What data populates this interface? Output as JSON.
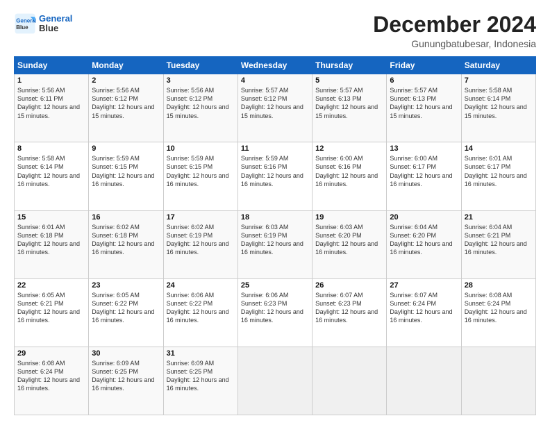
{
  "logo": {
    "line1": "General",
    "line2": "Blue"
  },
  "header": {
    "month": "December 2024",
    "location": "Gunungbatubesar, Indonesia"
  },
  "weekdays": [
    "Sunday",
    "Monday",
    "Tuesday",
    "Wednesday",
    "Thursday",
    "Friday",
    "Saturday"
  ],
  "weeks": [
    [
      {
        "day": "1",
        "sunrise": "5:56 AM",
        "sunset": "6:11 PM",
        "daylight": "12 hours and 15 minutes."
      },
      {
        "day": "2",
        "sunrise": "5:56 AM",
        "sunset": "6:12 PM",
        "daylight": "12 hours and 15 minutes."
      },
      {
        "day": "3",
        "sunrise": "5:56 AM",
        "sunset": "6:12 PM",
        "daylight": "12 hours and 15 minutes."
      },
      {
        "day": "4",
        "sunrise": "5:57 AM",
        "sunset": "6:12 PM",
        "daylight": "12 hours and 15 minutes."
      },
      {
        "day": "5",
        "sunrise": "5:57 AM",
        "sunset": "6:13 PM",
        "daylight": "12 hours and 15 minutes."
      },
      {
        "day": "6",
        "sunrise": "5:57 AM",
        "sunset": "6:13 PM",
        "daylight": "12 hours and 15 minutes."
      },
      {
        "day": "7",
        "sunrise": "5:58 AM",
        "sunset": "6:14 PM",
        "daylight": "12 hours and 15 minutes."
      }
    ],
    [
      {
        "day": "8",
        "sunrise": "5:58 AM",
        "sunset": "6:14 PM",
        "daylight": "12 hours and 16 minutes."
      },
      {
        "day": "9",
        "sunrise": "5:59 AM",
        "sunset": "6:15 PM",
        "daylight": "12 hours and 16 minutes."
      },
      {
        "day": "10",
        "sunrise": "5:59 AM",
        "sunset": "6:15 PM",
        "daylight": "12 hours and 16 minutes."
      },
      {
        "day": "11",
        "sunrise": "5:59 AM",
        "sunset": "6:16 PM",
        "daylight": "12 hours and 16 minutes."
      },
      {
        "day": "12",
        "sunrise": "6:00 AM",
        "sunset": "6:16 PM",
        "daylight": "12 hours and 16 minutes."
      },
      {
        "day": "13",
        "sunrise": "6:00 AM",
        "sunset": "6:17 PM",
        "daylight": "12 hours and 16 minutes."
      },
      {
        "day": "14",
        "sunrise": "6:01 AM",
        "sunset": "6:17 PM",
        "daylight": "12 hours and 16 minutes."
      }
    ],
    [
      {
        "day": "15",
        "sunrise": "6:01 AM",
        "sunset": "6:18 PM",
        "daylight": "12 hours and 16 minutes."
      },
      {
        "day": "16",
        "sunrise": "6:02 AM",
        "sunset": "6:18 PM",
        "daylight": "12 hours and 16 minutes."
      },
      {
        "day": "17",
        "sunrise": "6:02 AM",
        "sunset": "6:19 PM",
        "daylight": "12 hours and 16 minutes."
      },
      {
        "day": "18",
        "sunrise": "6:03 AM",
        "sunset": "6:19 PM",
        "daylight": "12 hours and 16 minutes."
      },
      {
        "day": "19",
        "sunrise": "6:03 AM",
        "sunset": "6:20 PM",
        "daylight": "12 hours and 16 minutes."
      },
      {
        "day": "20",
        "sunrise": "6:04 AM",
        "sunset": "6:20 PM",
        "daylight": "12 hours and 16 minutes."
      },
      {
        "day": "21",
        "sunrise": "6:04 AM",
        "sunset": "6:21 PM",
        "daylight": "12 hours and 16 minutes."
      }
    ],
    [
      {
        "day": "22",
        "sunrise": "6:05 AM",
        "sunset": "6:21 PM",
        "daylight": "12 hours and 16 minutes."
      },
      {
        "day": "23",
        "sunrise": "6:05 AM",
        "sunset": "6:22 PM",
        "daylight": "12 hours and 16 minutes."
      },
      {
        "day": "24",
        "sunrise": "6:06 AM",
        "sunset": "6:22 PM",
        "daylight": "12 hours and 16 minutes."
      },
      {
        "day": "25",
        "sunrise": "6:06 AM",
        "sunset": "6:23 PM",
        "daylight": "12 hours and 16 minutes."
      },
      {
        "day": "26",
        "sunrise": "6:07 AM",
        "sunset": "6:23 PM",
        "daylight": "12 hours and 16 minutes."
      },
      {
        "day": "27",
        "sunrise": "6:07 AM",
        "sunset": "6:24 PM",
        "daylight": "12 hours and 16 minutes."
      },
      {
        "day": "28",
        "sunrise": "6:08 AM",
        "sunset": "6:24 PM",
        "daylight": "12 hours and 16 minutes."
      }
    ],
    [
      {
        "day": "29",
        "sunrise": "6:08 AM",
        "sunset": "6:24 PM",
        "daylight": "12 hours and 16 minutes."
      },
      {
        "day": "30",
        "sunrise": "6:09 AM",
        "sunset": "6:25 PM",
        "daylight": "12 hours and 16 minutes."
      },
      {
        "day": "31",
        "sunrise": "6:09 AM",
        "sunset": "6:25 PM",
        "daylight": "12 hours and 16 minutes."
      },
      null,
      null,
      null,
      null
    ]
  ],
  "labels": {
    "sunrise": "Sunrise:",
    "sunset": "Sunset:",
    "daylight": "Daylight:"
  }
}
